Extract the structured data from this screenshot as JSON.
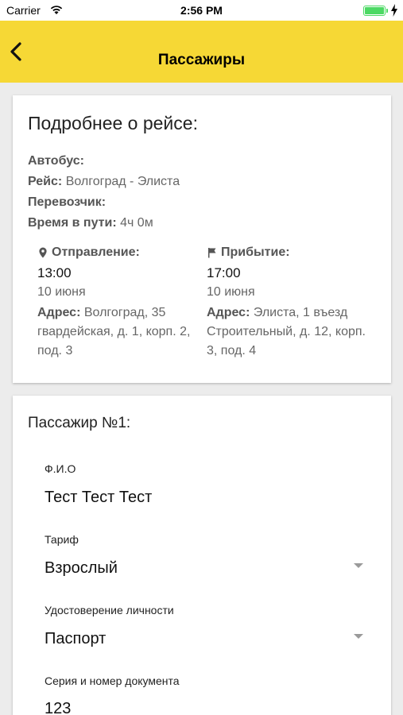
{
  "status_bar": {
    "carrier": "Carrier",
    "time": "2:56 PM"
  },
  "app_bar": {
    "title": "Пассажиры"
  },
  "trip": {
    "title": "Подробнее о рейсе:",
    "bus_label": "Автобус:",
    "route_label": "Рейс:",
    "route_value": "Волгоград - Элиста",
    "carrier_label": "Перевозчик:",
    "duration_label": "Время в пути:",
    "duration_value": "4ч 0м",
    "departure": {
      "label": "Отправление:",
      "time": "13:00",
      "date": "10 июня",
      "address_label": "Адрес:",
      "address": "Волгоград, 35 гвардейская, д. 1, корп. 2, под. 3"
    },
    "arrival": {
      "label": "Прибытие:",
      "time": "17:00",
      "date": "10 июня",
      "address_label": "Адрес:",
      "address": "Элиста, 1 въезд Строительный, д. 12, корп. 3, под. 4"
    }
  },
  "passenger": {
    "title": "Пассажир №1:",
    "fields": [
      {
        "label": "Ф.И.О",
        "value": "Тест Тест Тест"
      },
      {
        "label": "Тариф",
        "value": "Взрослый"
      },
      {
        "label": "Удостоверение личности",
        "value": "Паспорт"
      },
      {
        "label": "Серия и номер документа",
        "value": "123"
      }
    ]
  }
}
